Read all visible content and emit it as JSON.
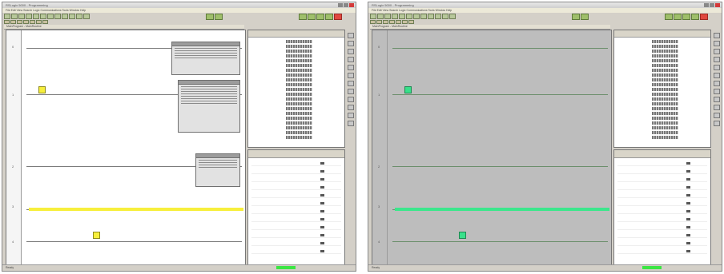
{
  "screenshots": [
    {
      "id": "offline",
      "title": "RSLogix 5000 - Programming",
      "menu": "File  Edit  View  Search  Logic  Communications  Tools  Window  Help",
      "doc_tab": "MainProgram - MainRoutine",
      "status": "Ready",
      "mode": "light"
    },
    {
      "id": "online",
      "title": "RSLogix 5000 - Programming",
      "menu": "File  Edit  View  Search  Logic  Communications  Tools  Window  Help",
      "doc_tab": "MainProgram - MainRoutine",
      "status": "Ready",
      "mode": "online"
    }
  ],
  "rung_numbers": [
    "0",
    "1",
    "2",
    "3",
    "4"
  ],
  "accent": {
    "highlight_offline": "#f7ef3c",
    "highlight_online": "#38e08a",
    "run_indicator": "#3ce644"
  }
}
